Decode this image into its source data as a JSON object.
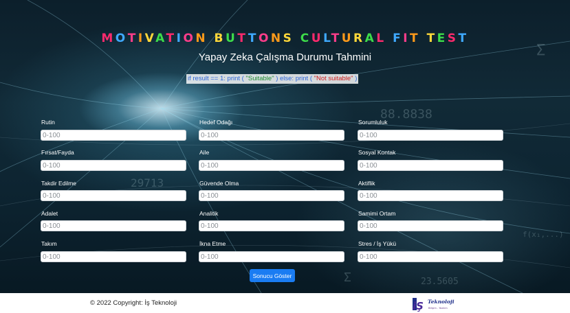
{
  "header": {
    "title": "MOTIVATION BUTTONS CULTURAL FIT TEST",
    "subtitle": "Yapay Zeka Çalışma Durumu Tahmini",
    "code": {
      "part1": "if result == 1: print (",
      "part2": "\"Suitable\"",
      "part3": ") else: print (",
      "part4": "\"Not suitable\"",
      "part5": ")"
    }
  },
  "colors": {
    "title_rainbow": [
      "#ff2a6d",
      "#3fa9ff",
      "#ff3d8a",
      "#ff9a1a",
      "#ffd83a",
      "#3ddc4a"
    ],
    "button": "#1a7cf2"
  },
  "fields": [
    {
      "label": "Rutin",
      "placeholder": "0-100"
    },
    {
      "label": "Hedef Odağı",
      "placeholder": "0-100"
    },
    {
      "label": "Sorumluluk",
      "placeholder": "0-100"
    },
    {
      "label": "Fırsat/Fayda",
      "placeholder": "0-100"
    },
    {
      "label": "Aile",
      "placeholder": "0-100"
    },
    {
      "label": "Sosyal Kontak",
      "placeholder": "0-100"
    },
    {
      "label": "Takdir Edilme",
      "placeholder": "0-100"
    },
    {
      "label": "Güvende Olma",
      "placeholder": "0-100"
    },
    {
      "label": "Aktiflik",
      "placeholder": "0-100"
    },
    {
      "label": "Adalet",
      "placeholder": "0-100"
    },
    {
      "label": "Analitik",
      "placeholder": "0-100"
    },
    {
      "label": "Samimi Ortam",
      "placeholder": "0-100"
    },
    {
      "label": "Takım",
      "placeholder": "0-100"
    },
    {
      "label": "İkna Etme",
      "placeholder": "0-100"
    },
    {
      "label": "Stres / İş Yükü",
      "placeholder": "0-100"
    }
  ],
  "submit_label": "Sonucu Göster",
  "footer": {
    "copyright": "© 2022 Copyright: İş Teknoloji",
    "logo_mark": "iŞ",
    "logo_name": "Teknoloji",
    "logo_tagline": "Bilişim - Yazılım"
  }
}
